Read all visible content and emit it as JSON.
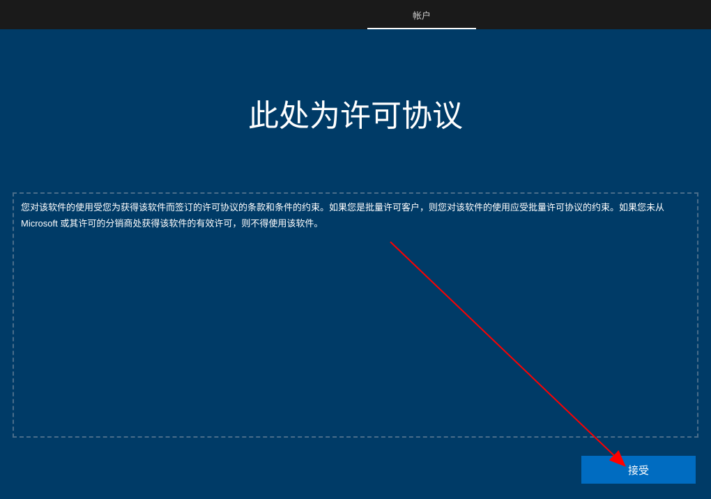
{
  "topbar": {
    "tab_label": "帐户"
  },
  "main": {
    "title": "此处为许可协议",
    "agreement_text": "您对该软件的使用受您为获得该软件而签订的许可协议的条款和条件的约束。如果您是批量许可客户，则您对该软件的使用应受批量许可协议的约束。如果您未从 Microsoft 或其许可的分销商处获得该软件的有效许可，则不得使用该软件。"
  },
  "buttons": {
    "accept_label": "接受"
  }
}
